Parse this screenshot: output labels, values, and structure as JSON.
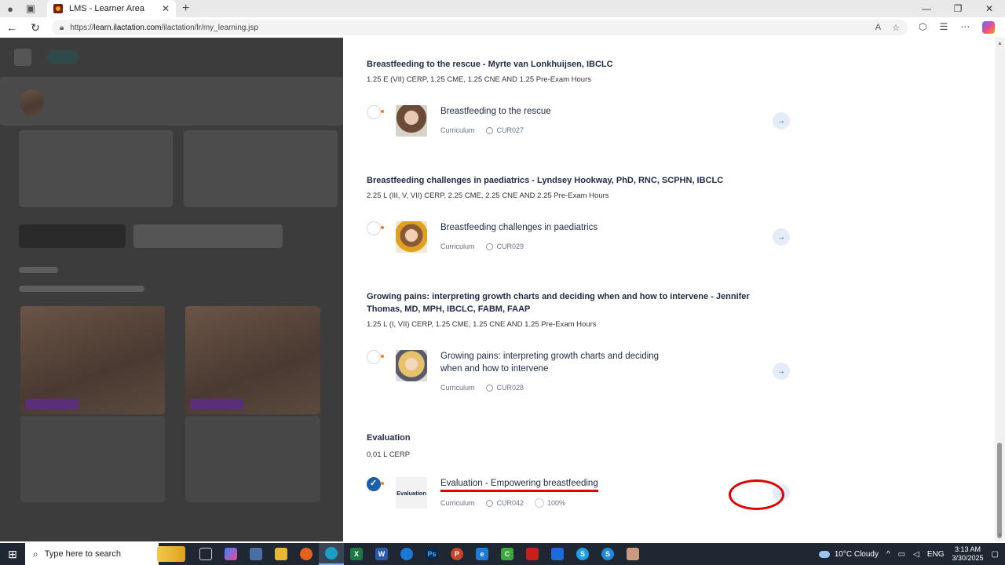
{
  "browser": {
    "tab_title": "LMS - Learner Area",
    "new_tab_label": "+",
    "url_prefix": "https://",
    "url_host": "learn.ilactation.com",
    "url_path": "/ilactation/lr/my_learning.jsp"
  },
  "sections": [
    {
      "title": "Breastfeeding to the rescue - Myrte van Lonkhuijsen, IBCLC",
      "subtitle": "1.25 E (VII) CERP, 1.25 CME, 1.25 CNE AND 1.25 Pre-Exam Hours",
      "item": {
        "title": "Breastfeeding to the rescue",
        "type": "Curriculum",
        "code": "CUR027",
        "status": "not-started"
      }
    },
    {
      "title": "Breastfeeding challenges in paediatrics - Lyndsey Hookway, PhD, RNC, SCPHN, IBCLC",
      "subtitle": "2.25 L (III, V, VII) CERP, 2.25 CME, 2.25 CNE AND 2.25 Pre-Exam Hours",
      "item": {
        "title": "Breastfeeding challenges in paediatrics",
        "type": "Curriculum",
        "code": "CUR029",
        "status": "not-started"
      }
    },
    {
      "title": "Growing pains: interpreting growth charts and deciding when and how to intervene - Jennifer Thomas, MD, MPH, IBCLC, FABM, FAAP",
      "subtitle": "1.25 L (I, VII) CERP, 1.25 CME, 1.25 CNE AND 1.25 Pre-Exam Hours",
      "item": {
        "title": "Growing pains: interpreting growth charts and deciding when and how to intervene",
        "type": "Curriculum",
        "code": "CUR028",
        "status": "not-started"
      }
    },
    {
      "title": "Evaluation",
      "subtitle": "0.01 L CERP",
      "item": {
        "title": "Evaluation - Empowering breastfeeding",
        "type": "Curriculum",
        "code": "CUR042",
        "progress": "100%",
        "thumb_text": "Evaluation",
        "status": "completed"
      }
    }
  ],
  "arrow_glyph": "→",
  "taskbar": {
    "search_placeholder": "Type here to search",
    "weather": "10°C  Cloudy",
    "language": "ENG",
    "time": "3:13 AM",
    "date": "3/30/2025"
  },
  "colors": {
    "title": "#1f2a44",
    "accent_blue": "#1a5fa8",
    "highlight_red": "#e00000",
    "overlay": "#3c3c3c"
  }
}
